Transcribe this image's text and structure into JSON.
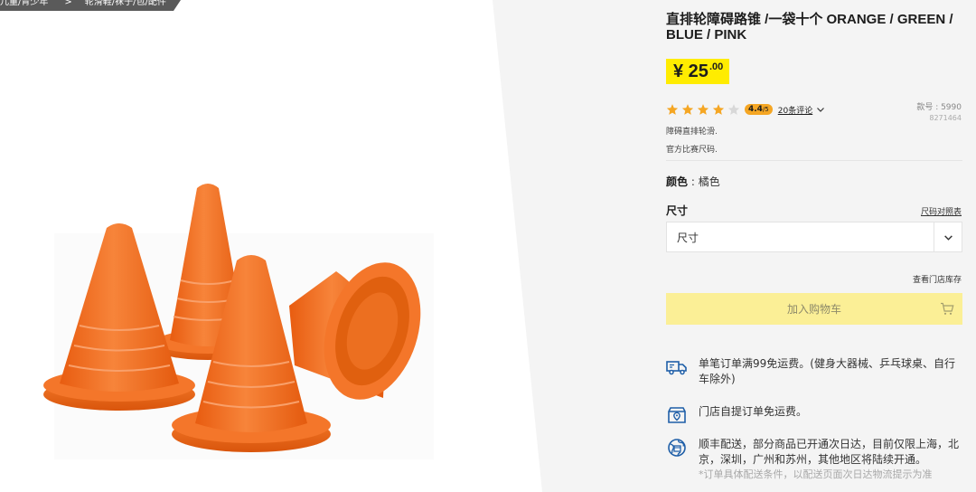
{
  "breadcrumb": {
    "items": [
      "儿童/青少年",
      "轮滑鞋/袜子/包/配件"
    ]
  },
  "product": {
    "title": "直排轮障碍路锥 /一袋十个 ORANGE / GREEN / BLUE / PINK",
    "price_main": "¥ 25",
    "price_decimal": ".00",
    "rating": {
      "stars": 4,
      "max_stars": 5,
      "score": "4.4",
      "score_suffix": "/5",
      "reviews_label": "20条评论"
    },
    "model": {
      "label": "款号 : 5990",
      "id": "8271464"
    },
    "description_lines": [
      "障碍直排轮滑.",
      "官方比赛尺码."
    ],
    "color": {
      "label": "颜色",
      "separator": " : ",
      "value": "橘色"
    },
    "size": {
      "label": "尺寸",
      "chart_link": "尺码对照表",
      "placeholder": "尺寸"
    },
    "store_stock_link": "查看门店库存",
    "add_to_cart": "加入购物车"
  },
  "benefits": [
    {
      "icon": "truck-icon",
      "text": "单笔订单满99免运费。(健身大器械、乒乓球桌、自行车除外)"
    },
    {
      "icon": "store-pickup-icon",
      "text": "门店自提订单免运费。"
    },
    {
      "icon": "globe-delivery-icon",
      "text": "顺丰配送，部分商品已开通次日达，目前仅限上海，北京，深圳，广州和苏州，其他地区将陆续开通。",
      "note": "*订单具体配送条件，以配送页面次日达物流提示为准"
    }
  ],
  "colors": {
    "price_bg": "#ffec00",
    "cart_btn_bg": "#fbef96",
    "rating_badge": "#f5a623",
    "star_filled": "#f5a623",
    "star_empty": "#d8d8d8",
    "icon_blue": "#1f5fa8",
    "cone_orange": "#f26e1a"
  }
}
